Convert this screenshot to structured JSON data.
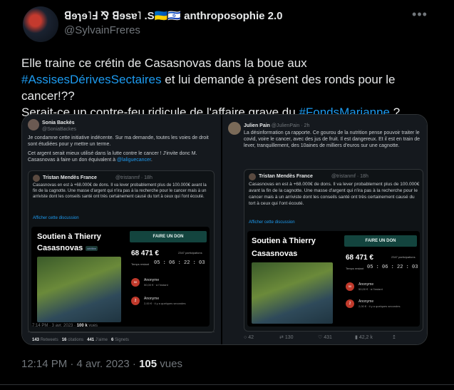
{
  "author": {
    "display_name": "ꓭɘɿɘ˥ꓞ ⅋ ꓭɘsɐ˥ .S🇺🇦🇮🇱 anthroposophie 2.0",
    "handle": "@SylvainFreres"
  },
  "more_icon": "more-horizontal-icon",
  "tweet": {
    "text_1": "Elle traine ce crétin de Casasnovas dans la boue aux ",
    "hashtag_1": "#AssisesDérivesSectaires",
    "text_2": " et lui demande à présent des ronds pour le cancer!??",
    "text_3": "Serait-ce un contre-feu ridicule de l'affaire grave du ",
    "hashtag_2": "#FondsMarianne",
    "text_4": " ?"
  },
  "left_panel": {
    "name": "Sonia Backès",
    "handle": "@SoniaBackes",
    "text_1": "Je condamne cette initiative indécente. Sur ma demande, toutes les voies de droit sont étudiées pour y mettre un terme.",
    "text_2": "Cet argent serait mieux utilisé dans la lutte contre le cancer ! J'invite donc M. Casasnovas à faire un don équivalent à ",
    "mention": "@laliguecancer",
    "text_2_end": ".",
    "quote": {
      "name": "Tristan Mendès France",
      "handle": "@tristanmf · 18h",
      "text": "Casasnovas en est à +68.000€ de dons. Il va lever probablement plus de 100.000€ avant la fin de la cagnotte. Une masse d'argent qui n'ira pas à la recherche pour le cancer mais à un arriviste dont les conseils santé ont très certainement causé du tort à ceux qui l'ont écouté.",
      "show": "Afficher cette discussion"
    },
    "card": {
      "title_1": "Soutien à Thierry",
      "title_2": "Casasnovas",
      "verified": "vérifiée",
      "donate": "FAIRE UN DON",
      "amount": "68 471 €",
      "participations": "2347 participations",
      "remaining_label": "Temps restant",
      "countdown": "05 : 06 : 22 : 03",
      "donor_1_amount": "50",
      "donor_1_name": "Anonyme",
      "donor_1_detail": "50,00 € · à l'instant",
      "donor_2_amount": "2",
      "donor_2_name": "Anonyme",
      "donor_2_detail": "2,00 € · il y a quelques secondes"
    },
    "meta_time": "7:14 PM · 3 avr. 2023 · ",
    "meta_views": "100 k",
    "meta_views_label": " vues",
    "stats": {
      "retweets": "143",
      "retweets_label": "Retweets",
      "quotes": "16",
      "quotes_label": "citations",
      "likes": "441",
      "likes_label": "J'aime",
      "bookmarks": "6",
      "bookmarks_label": "Signets"
    }
  },
  "right_panel": {
    "name": "Julien Pain",
    "handle": "@JulienPain · 2h",
    "text": "La désinformation ça rapporte. Ce gourou de la nutrition pense pouvoir traiter le covid, voire le cancer, avec des jus de fruit. Il est dangereux. Et il est en train de lever, tranquillement, des 10aines de milliers d'euros sur une cagnotte.",
    "quote": {
      "name": "Tristan Mendès France",
      "handle": "@tristanmf · 18h",
      "text": "Casasnovas en est à +68.000€ de dons. Il va lever probablement plus de 100.000€ avant la fin de la cagnotte. Une masse d'argent qui n'ira pas à la recherche pour le cancer mais à un arriviste dont les conseils santé ont très certainement causé du tort à ceux qui l'ont écouté.",
      "show": "Afficher cette discussion"
    },
    "card": {
      "title_1": "Soutien à Thierry",
      "title_2": "Casasnovas",
      "donate": "FAIRE UN DON",
      "amount": "68 471 €",
      "participations": "2347 participations",
      "remaining_label": "Temps restant",
      "countdown": "05 : 06 : 22 : 03",
      "donor_1_amount": "50",
      "donor_1_name": "Anonyme",
      "donor_1_detail": "50,00 € · à l'instant",
      "donor_2_amount": "2",
      "donor_2_name": "Anonyme",
      "donor_2_detail": "2,00 € · il y a quelques secondes"
    },
    "actions": {
      "replies": "42",
      "retweets": "130",
      "likes": "431",
      "views": "42,2 k"
    }
  },
  "footer": {
    "time": "12:14 PM · 4 avr. 2023 · ",
    "views": "105",
    "views_label": " vues"
  }
}
